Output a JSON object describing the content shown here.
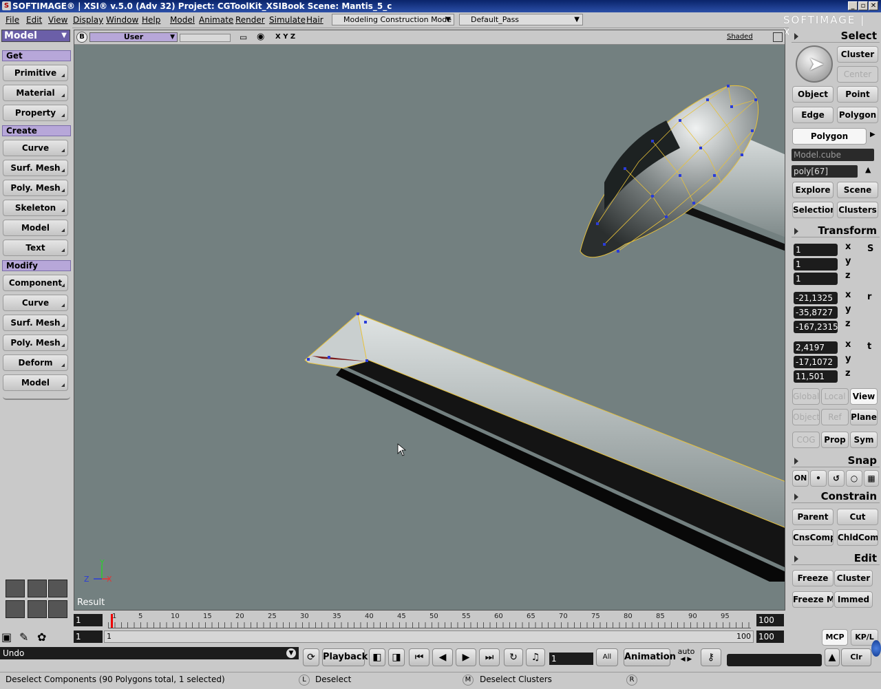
{
  "window": {
    "title": "SOFTIMAGE® | XSI® v.5.0 (Adv 32) Project: CGToolKit_XSIBook    Scene: Mantis_5_c",
    "brand": "SOFTIMAGE | XSI"
  },
  "menubar": {
    "items": [
      "File",
      "Edit",
      "View",
      "Display",
      "Window",
      "Help",
      "Model",
      "Animate",
      "Render",
      "Simulate",
      "Hair"
    ],
    "mode_combo": "Modeling Construction Mode",
    "pass_combo": "Default_Pass"
  },
  "left_panel": {
    "module": "Model",
    "sections": [
      {
        "header": "Get",
        "items": [
          "Primitive",
          "Material",
          "Property"
        ]
      },
      {
        "header": "Create",
        "items": [
          "Curve",
          "Surf. Mesh",
          "Poly. Mesh",
          "Skeleton",
          "Model",
          "Text"
        ]
      },
      {
        "header": "Modify",
        "items": [
          "Component",
          "Curve",
          "Surf. Mesh",
          "Poly. Mesh",
          "Deform",
          "Model"
        ]
      }
    ]
  },
  "viewport": {
    "badge": "B",
    "camera": "User",
    "axes": "X  Y  Z",
    "display_mode": "Shaded",
    "label": "Result",
    "axis_y": "Y",
    "axis_z": "Z",
    "axis_x": "X"
  },
  "right_panel": {
    "select_header": "Select",
    "cluster": "Cluster",
    "center": "Center",
    "object": "Object",
    "point": "Point",
    "edge": "Edge",
    "polygon": "Polygon",
    "filter": "Polygon",
    "selected_object": "Model.cube",
    "selected_component": "poly[67]",
    "explore": "Explore",
    "scene": "Scene",
    "selection": "Selection",
    "clusters": "Clusters",
    "transform_header": "Transform",
    "scale": [
      "1",
      "1",
      "1"
    ],
    "rotation": [
      "-21,1325",
      "-35,8727",
      "-167,2315"
    ],
    "translation": [
      "2,4197",
      "-17,1072",
      "11,501"
    ],
    "axis_labels": [
      "x",
      "y",
      "z"
    ],
    "s_label": "S",
    "r_label": "r",
    "t_label": "t",
    "global": "Global",
    "local": "Local",
    "view": "View",
    "object_ref": "Object",
    "ref": "Ref",
    "plane": "Plane",
    "cog": "COG",
    "prop": "Prop",
    "sym": "Sym",
    "snap_header": "Snap",
    "snap_on": "ON",
    "constrain_header": "Constrain",
    "parent": "Parent",
    "cut": "Cut",
    "cnscomp": "CnsComp",
    "chldcomp": "ChldComp",
    "edit_header": "Edit",
    "freeze": "Freeze",
    "cluster_edit": "Cluster",
    "freeze_m": "Freeze M",
    "immed": "Immed",
    "mcp": "MCP",
    "kpl": "KP/L"
  },
  "timeline": {
    "start": "1",
    "ticks": [
      "1",
      "5",
      "10",
      "15",
      "20",
      "25",
      "30",
      "35",
      "40",
      "45",
      "50",
      "55",
      "60",
      "65",
      "70",
      "75",
      "80",
      "85",
      "90",
      "95"
    ],
    "end": "100",
    "range_start": "1",
    "range_label": "1",
    "range_end_label": "100",
    "range_end": "100"
  },
  "bottom": {
    "undo": "Undo",
    "playback": "Playback",
    "current_frame": "1",
    "all": "All",
    "animation": "Animation",
    "auto": "auto",
    "clr": "Clr"
  },
  "status": {
    "message": "Deselect Components (90 Polygons total, 1 selected)",
    "l_key": "L",
    "l_action": "Deselect",
    "m_key": "M",
    "m_action": "Deselect Clusters",
    "r_key": "R"
  }
}
